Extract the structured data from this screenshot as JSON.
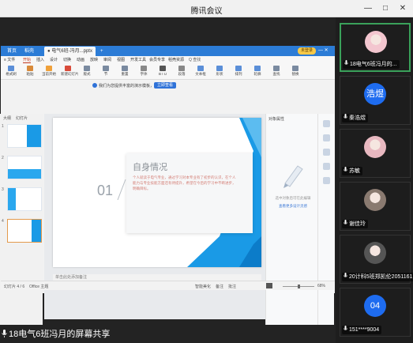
{
  "window": {
    "title": "腾讯会议",
    "minimize": "—",
    "maximize": "□",
    "close": "✕"
  },
  "shared_screen": {
    "tabs": [
      {
        "label": "首页",
        "active": false
      },
      {
        "label": "稻壳",
        "active": false
      },
      {
        "label": "● 电气6班-冯月...pptx",
        "active": true
      },
      {
        "label": "+",
        "active": false
      }
    ],
    "login_button": "未登录",
    "menu": [
      {
        "label": "≡ 文件",
        "active": false
      },
      {
        "label": "开始",
        "active": true
      },
      {
        "label": "插入",
        "active": false
      },
      {
        "label": "设计",
        "active": false
      },
      {
        "label": "切换",
        "active": false
      },
      {
        "label": "动画",
        "active": false
      },
      {
        "label": "放映",
        "active": false
      },
      {
        "label": "审阅",
        "active": false
      },
      {
        "label": "视图",
        "active": false
      },
      {
        "label": "开发工具",
        "active": false
      },
      {
        "label": "会员专享",
        "active": false
      },
      {
        "label": "稻壳资源",
        "active": false
      }
    ],
    "search_label": "Q 查找",
    "ribbon": [
      {
        "label": "格式刷",
        "color": "#5b8fd8"
      },
      {
        "label": "粘贴",
        "color": "#d98a3a"
      },
      {
        "label": "当前开始",
        "color": "#f0a13a"
      },
      {
        "label": "新建幻灯片",
        "color": "#d94b3a"
      },
      {
        "label": "版式",
        "color": "#7a8aa0"
      },
      {
        "label": "节",
        "color": "#7a8aa0"
      },
      {
        "label": "重置",
        "color": "#7a8aa0"
      },
      {
        "label": "字体",
        "color": "#888"
      },
      {
        "label": "B I U",
        "color": "#555"
      },
      {
        "label": "段落",
        "color": "#888"
      },
      {
        "label": "文本框",
        "color": "#5b8fd8"
      },
      {
        "label": "形状",
        "color": "#5b8fd8"
      },
      {
        "label": "排列",
        "color": "#5b8fd8"
      },
      {
        "label": "轮廓",
        "color": "#5b8fd8"
      },
      {
        "label": "查找",
        "color": "#7a8aa0"
      },
      {
        "label": "替换",
        "color": "#7a8aa0"
      }
    ],
    "infobar": {
      "text": "我们为您提供丰富的演示模板，可直接套用",
      "button": "立即查看"
    },
    "thumbs_header": [
      "大纲",
      "幻灯片"
    ],
    "slide_count": 6,
    "selected_slide": 4,
    "slide": {
      "number": "01",
      "heading": "自身情况",
      "body": "个人就读于电气专业，通过学习对本专业有了初步的认识，在个人能力与专业技能方面还有待提升，希望在今后的学习中不断进步，明确目标。"
    },
    "notes": "单击此处添加备注",
    "right_panel": {
      "header": "对象属性",
      "hint": "选中对象后可在此编辑",
      "link": "查看更多设计灵感"
    },
    "status": {
      "slide_label": "幻灯片 4 / 6",
      "theme": "Office 主题",
      "smart": "智能美化",
      "notes_btn": "备注",
      "comment_btn": "批注",
      "zoom": "68%"
    }
  },
  "share_caption": "18电气6班冯月的屏幕共享",
  "participants": [
    {
      "name": "18电气6班冯月的...",
      "avatar_text": "",
      "avatar_color": "#f3c6cf",
      "active": true
    },
    {
      "name": "秦浩煜",
      "avatar_text": "浩煜",
      "avatar_color": "#1e6cf0",
      "active": false
    },
    {
      "name": "苏敏",
      "avatar_text": "",
      "avatar_color": "#e8b8c0",
      "active": false
    },
    {
      "name": "谢佳玲",
      "avatar_text": "",
      "avatar_color": "#8a7a70",
      "active": false
    },
    {
      "name": "20计科5班郑凯伦2051161...",
      "avatar_text": "",
      "avatar_color": "#555555",
      "active": false
    },
    {
      "name": "151****9004",
      "avatar_text": "04",
      "avatar_color": "#1e6cf0",
      "active": false
    }
  ]
}
